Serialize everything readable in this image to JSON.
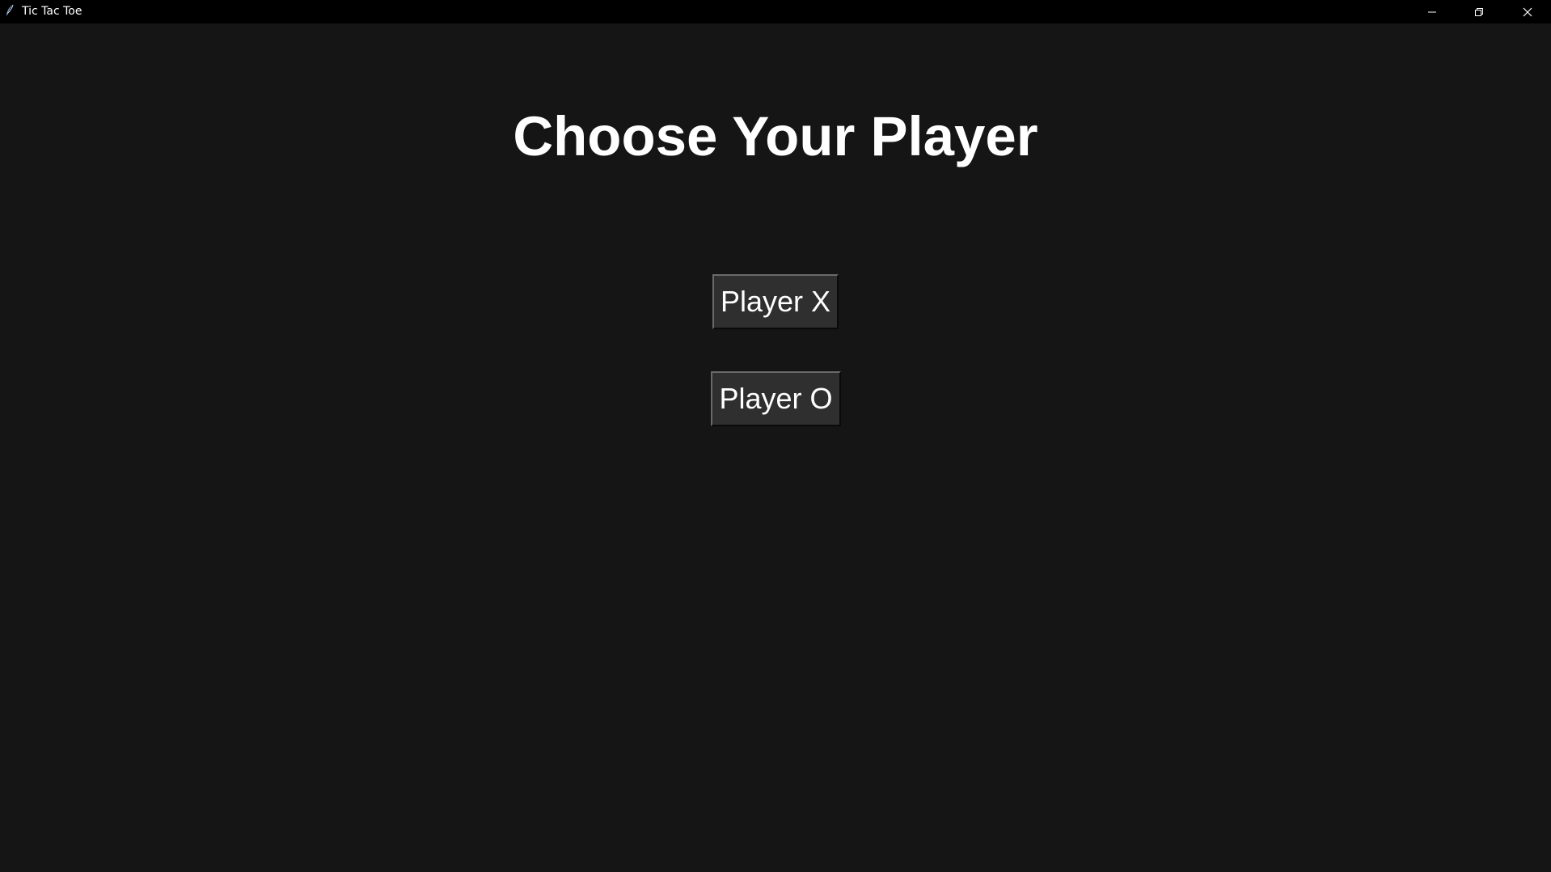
{
  "window": {
    "title": "Tic Tac Toe",
    "icon": "feather-icon",
    "controls": [
      "minimize-icon",
      "restore-icon",
      "close-icon"
    ]
  },
  "main": {
    "heading": "Choose Your Player",
    "buttons": {
      "player_x": "Player X",
      "player_o": "Player O"
    }
  },
  "colors": {
    "background": "#151515",
    "titlebar": "#000000",
    "button": "#2f2f2f",
    "text": "#ffffff"
  }
}
